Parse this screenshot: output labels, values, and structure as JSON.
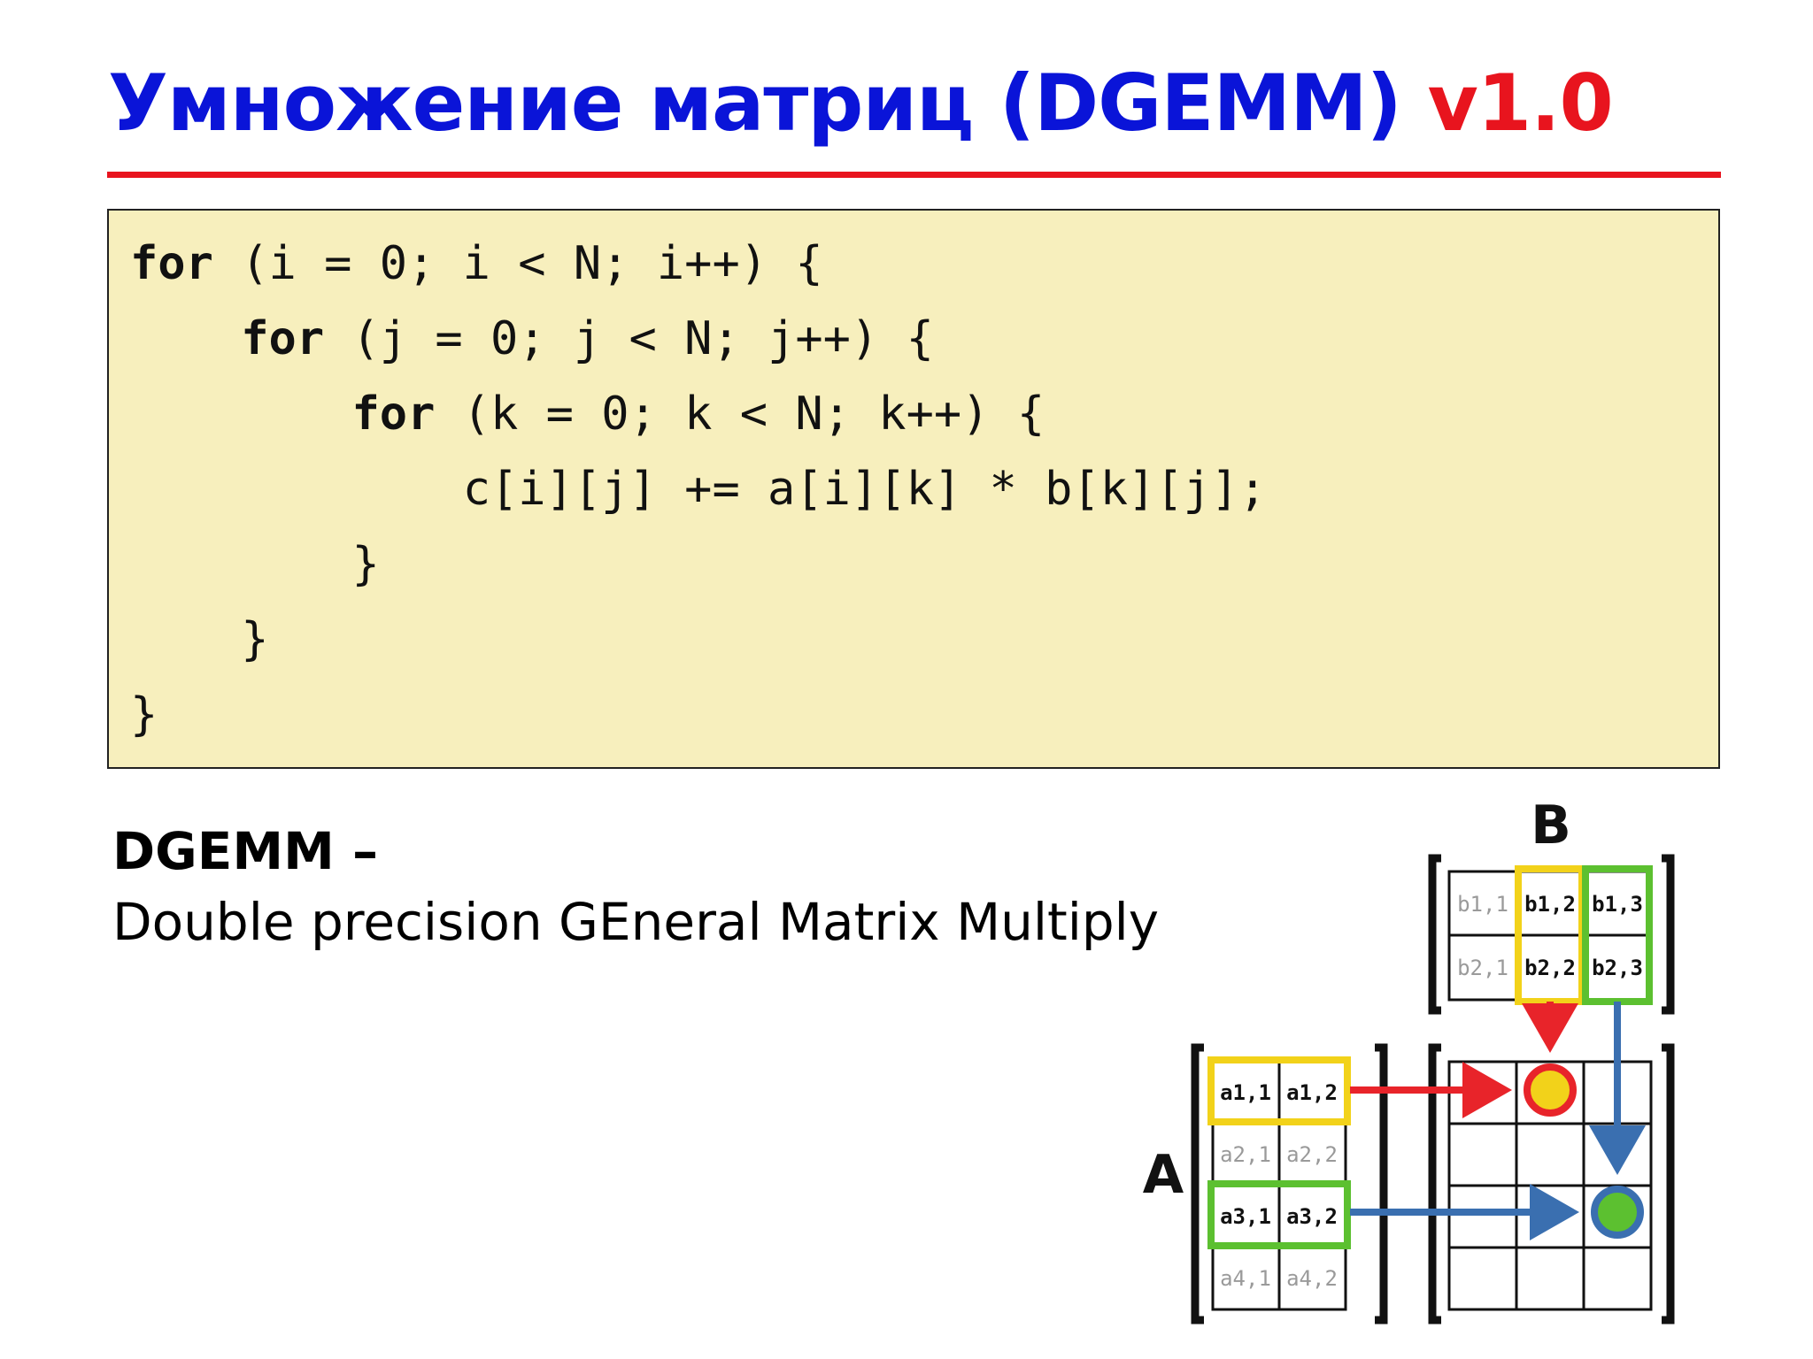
{
  "slide": {
    "title_main": "Умножение матриц (DGEMM)",
    "title_version": "v1.0"
  },
  "code": {
    "lines": [
      {
        "kw": "for",
        "rest": " (i = 0; i < N; i++) {",
        "indent": ""
      },
      {
        "kw": "for",
        "rest": " (j = 0; j < N; j++) {",
        "indent": "    "
      },
      {
        "kw": "for",
        "rest": " (k = 0; k < N; k++) {",
        "indent": "        "
      },
      {
        "kw": "",
        "rest": "c[i][j] += a[i][k] * b[k][j];",
        "indent": "            "
      },
      {
        "kw": "",
        "rest": "}",
        "indent": "        "
      },
      {
        "kw": "",
        "rest": "}",
        "indent": "    "
      },
      {
        "kw": "",
        "rest": "}",
        "indent": ""
      }
    ]
  },
  "definition": {
    "heading": "DGEMM –",
    "text": "Double precision GEneral Matrix Multiply"
  },
  "diagram": {
    "label_a": "A",
    "label_b": "B",
    "matrix_a": [
      [
        "a1,1",
        "a1,2"
      ],
      [
        "a2,1",
        "a2,2"
      ],
      [
        "a3,1",
        "a3,2"
      ],
      [
        "a4,1",
        "a4,2"
      ]
    ],
    "matrix_b": [
      [
        "b1,1",
        "b1,2",
        "b1,3"
      ],
      [
        "b2,1",
        "b2,2",
        "b2,3"
      ]
    ],
    "colors": {
      "yellow": "#f2d21a",
      "green": "#5cc030",
      "red": "#e8242a",
      "blue": "#3a6fb0",
      "inactive_text": "#9a9a9a"
    }
  }
}
